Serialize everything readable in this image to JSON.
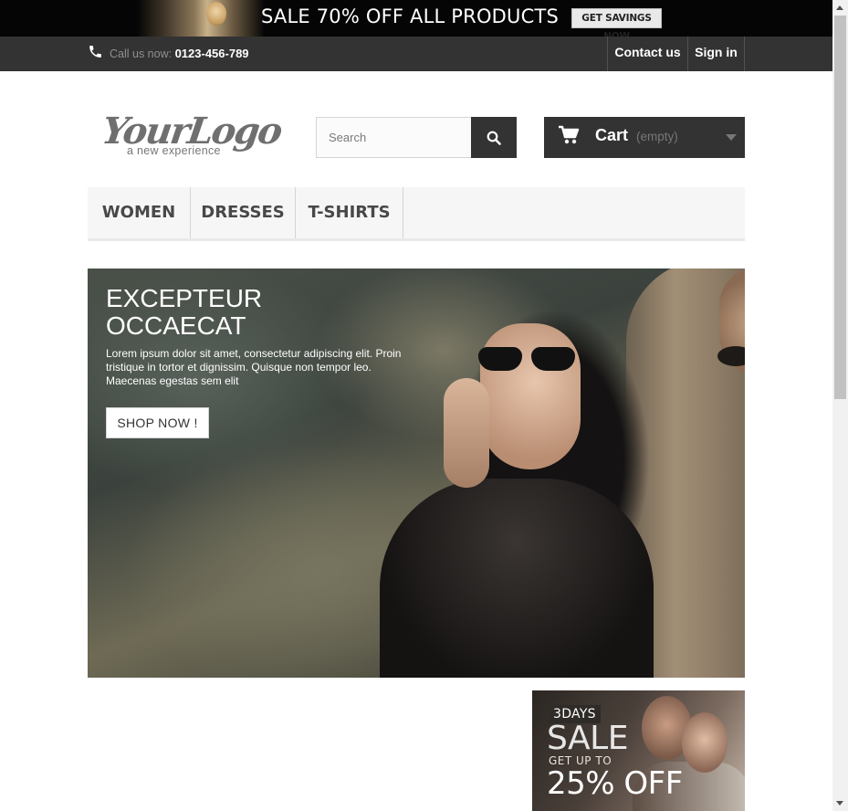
{
  "promo_banner": {
    "text": "SALE 70% OFF ALL PRODUCTS",
    "button_label": "GET SAVINGS NOW"
  },
  "top_nav": {
    "call_label": "Call us now:",
    "phone_number": "0123-456-789",
    "contact_label": "Contact us",
    "signin_label": "Sign in"
  },
  "header": {
    "logo_main": "YourLogo",
    "logo_sub": "a new experience",
    "search_placeholder": "Search",
    "search_value": "",
    "cart_label": "Cart",
    "cart_status": "(empty)"
  },
  "menu": {
    "items": [
      {
        "label": "WOMEN"
      },
      {
        "label": "DRESSES"
      },
      {
        "label": "T-SHIRTS"
      }
    ]
  },
  "hero": {
    "title_line1": "EXCEPTEUR",
    "title_line2": "OCCAECAT",
    "text": "Lorem ipsum dolor sit amet, consectetur adipiscing elit. Proin tristique in tortor et dignissim. Quisque non tempor leo. Maecenas egestas sem elit",
    "button_label": "SHOP NOW !"
  },
  "side_ad": {
    "days": "3DAYS",
    "sale": "SALE",
    "upto": "GET UP TO",
    "discount": "25% OFF"
  },
  "icons": {
    "phone": "phone-icon",
    "search": "search-icon",
    "cart": "cart-icon",
    "dropdown": "caret-down-icon"
  },
  "colors": {
    "nav_bg": "#333333",
    "menu_bg": "#f6f6f6",
    "promo_bg": "#050505"
  }
}
